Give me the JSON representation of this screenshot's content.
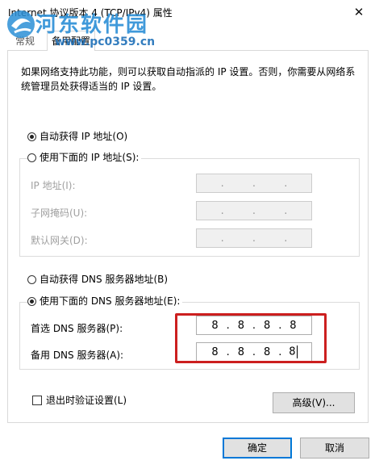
{
  "window": {
    "title": "Internet 协议版本 4 (TCP/IPv4) 属性",
    "close_glyph": "✕"
  },
  "watermark": {
    "main_text": "河东软件园",
    "url_text": "www.pc0359.cn"
  },
  "tabs": [
    {
      "label": "常规"
    },
    {
      "label": "备用配置"
    }
  ],
  "description": "如果网络支持此功能，则可以获取自动指派的 IP 设置。否则，你需要从网络系统管理员处获得适当的 IP 设置。",
  "ip_section": {
    "auto_label": "自动获得 IP 地址(O)",
    "manual_label": "使用下面的 IP 地址(S):",
    "auto_selected": true,
    "fields": [
      {
        "label": "IP 地址(I):",
        "value": [
          ".",
          ".",
          "."
        ]
      },
      {
        "label": "子网掩码(U):",
        "value": [
          ".",
          ".",
          "."
        ]
      },
      {
        "label": "默认网关(D):",
        "value": [
          ".",
          ".",
          "."
        ]
      }
    ]
  },
  "dns_section": {
    "auto_label": "自动获得 DNS 服务器地址(B)",
    "manual_label": "使用下面的 DNS 服务器地址(E):",
    "manual_selected": true,
    "preferred": {
      "label": "首选 DNS 服务器(P):",
      "octets": [
        "8",
        "8",
        "8",
        "8"
      ]
    },
    "alternate": {
      "label": "备用 DNS 服务器(A):",
      "octets": [
        "8",
        "8",
        "8",
        "8"
      ]
    }
  },
  "validate_label": "退出时验证设置(L)",
  "advanced_label": "高级(V)...",
  "ok_label": "确定",
  "cancel_label": "取消",
  "colors": {
    "highlight": "#cc1f1f",
    "primary_border": "#0078d7",
    "watermark": "#2b8fd6"
  }
}
